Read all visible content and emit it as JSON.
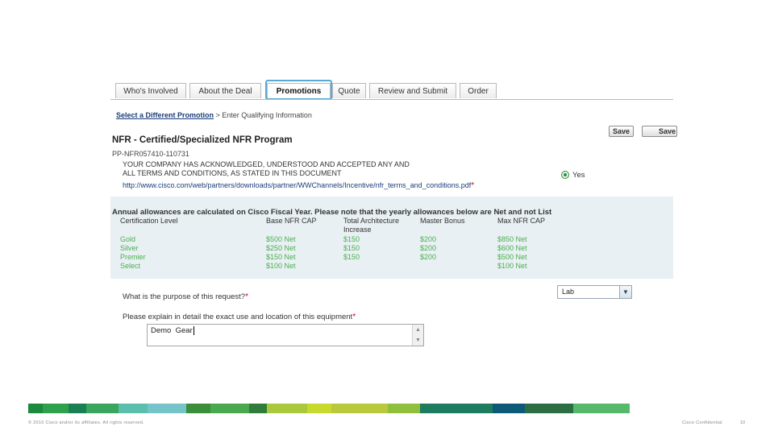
{
  "tabs": [
    {
      "label": "Who's Involved"
    },
    {
      "label": "About the Deal"
    },
    {
      "label": "Promotions"
    },
    {
      "label": "Quote"
    },
    {
      "label": "Review and Submit"
    },
    {
      "label": "Order"
    }
  ],
  "breadcrumb": {
    "link": "Select a Different Promotion",
    "rest": " > Enter Qualifying Information"
  },
  "buttons": {
    "save1": "Save",
    "save2": "Save"
  },
  "program": {
    "title": "NFR - Certified/Specialized NFR Program",
    "code": "PP-NFR057410-110731",
    "ack_line1": "YOUR COMPANY HAS ACKNOWLEDGED, UNDERSTOOD AND ACCEPTED ANY AND",
    "ack_line2": "ALL TERMS AND CONDITIONS, AS STATED IN THIS DOCUMENT",
    "link": "http://www.cisco.com/web/partners/downloads/partner/WWChannels/Incentive/nfr_terms_and_conditions.pdf",
    "required_mark": "*",
    "yes_label": "Yes"
  },
  "allowances": {
    "heading": "Annual allowances are calculated on Cisco Fiscal Year. Please note that the yearly allowances below are Net and not List",
    "headers": [
      "Certification Level",
      "Base NFR CAP",
      "Total Architecture Increase",
      "Master Bonus",
      "Max NFR CAP"
    ],
    "rows": [
      [
        "Gold",
        "$500 Net",
        "$150",
        "$200",
        "$850 Net"
      ],
      [
        "Silver",
        "$250 Net",
        "$150",
        "$200",
        "$600 Net"
      ],
      [
        "Premier",
        "$150 Net",
        "$150",
        "$200",
        "$500 Net"
      ],
      [
        "Select",
        "$100 Net",
        "",
        "",
        "$100 Net"
      ]
    ]
  },
  "questions": {
    "purpose_label": "What is the purpose of this request?",
    "purpose_value": "Lab",
    "explain_label": "Please explain in detail the exact use and location of this equipment",
    "explain_value": "Demo  Gear"
  },
  "footer": {
    "copyright": "© 2010 Cisco and/or its affiliates. All rights reserved.",
    "confidential": "Cisco Confidential",
    "page": "10"
  },
  "colors": {
    "accent": "#5aa9d6",
    "allowance_bg": "#e8f0f3",
    "green_text": "#4caf50",
    "stripe": [
      "#1c8a3e",
      "#2fa04b",
      "#1b7f54",
      "#3aa55c",
      "#5bbfae",
      "#74c4c9",
      "#3b8f3a",
      "#4aa84f",
      "#2f7d3a",
      "#a9c83c",
      "#c8d92e",
      "#b8c93b",
      "#8fbf3b",
      "#1d7b5f",
      "#0d5a78",
      "#2d6d42",
      "#55b86a"
    ]
  }
}
